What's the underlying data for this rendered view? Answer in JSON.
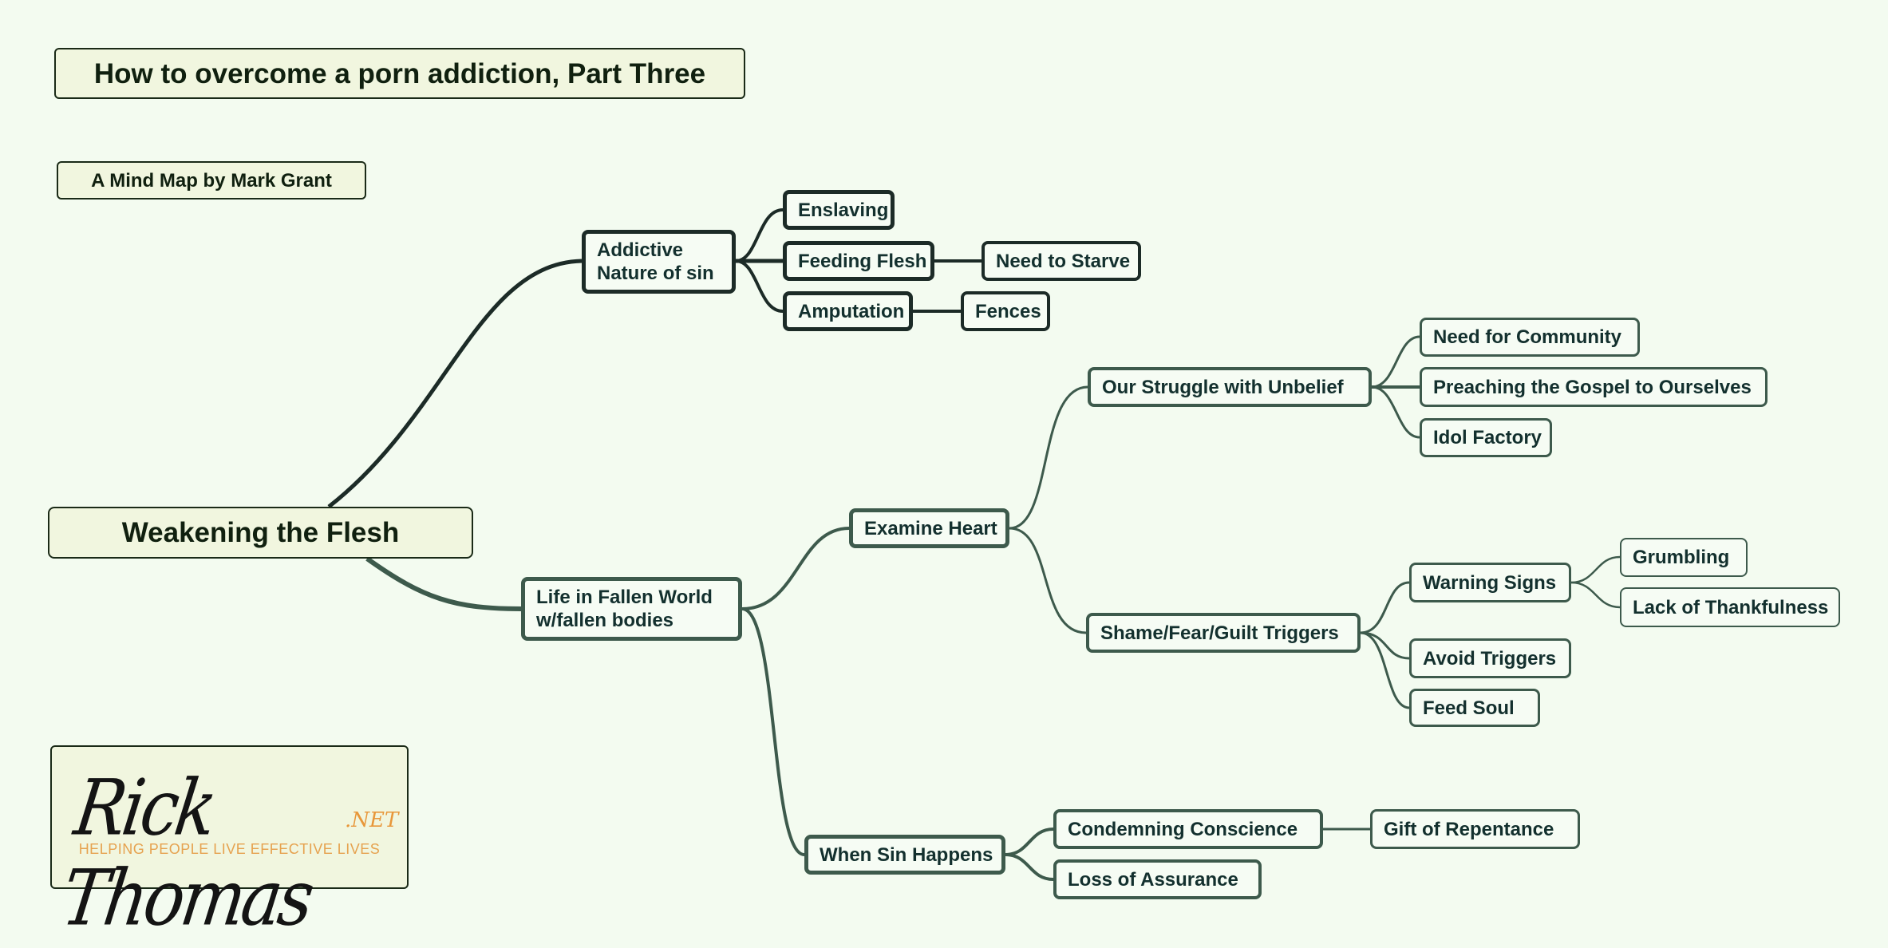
{
  "title": "How to overcome a porn addiction, Part Three",
  "subtitle": "A Mind Map by Mark Grant",
  "colors": {
    "background": "#f3fbf0",
    "node_fill": "#f6fcf4",
    "banner_fill": "#f1f6df",
    "dark_branch": "#1c2b27",
    "green_branch": "#3d5a4c",
    "text": "#13302e",
    "logo_accent": "#e8973a"
  },
  "root": {
    "label": "Weakening the Flesh"
  },
  "branches": {
    "addictive": {
      "label_line1": "Addictive",
      "label_line2": "Nature of sin",
      "children": {
        "enslaving": "Enslaving",
        "feeding_flesh": "Feeding Flesh",
        "need_to_starve": "Need to Starve",
        "amputation": "Amputation",
        "fences": "Fences"
      }
    },
    "fallen_world": {
      "label_line1": "Life in Fallen World",
      "label_line2": "w/fallen bodies",
      "examine_heart": {
        "label": "Examine Heart",
        "struggle": {
          "label": "Our Struggle with Unbelief",
          "children": [
            "Need for Community",
            "Preaching the Gospel to Ourselves",
            "Idol Factory"
          ]
        },
        "triggers": {
          "label": "Shame/Fear/Guilt Triggers",
          "warning_signs": {
            "label": "Warning Signs",
            "children": [
              "Grumbling",
              "Lack of Thankfulness"
            ]
          },
          "avoid": "Avoid Triggers",
          "feed_soul": "Feed Soul"
        }
      },
      "when_sin": {
        "label": "When Sin Happens",
        "condemning": "Condemning Conscience",
        "gift": "Gift of Repentance",
        "loss": "Loss of Assurance"
      }
    }
  },
  "logo": {
    "name": "Rick Thomas",
    "tld": ".NET",
    "tagline": "HELPING PEOPLE LIVE EFFECTIVE LIVES"
  }
}
